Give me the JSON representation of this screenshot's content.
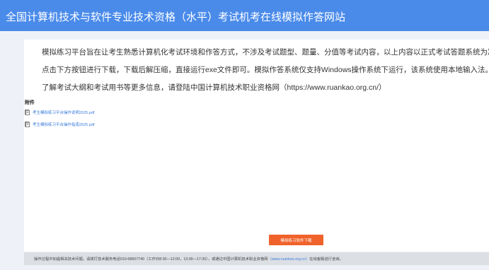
{
  "header": {
    "title": "全国计算机技术与软件专业技术资格（水平）考试机考在线模拟作答网站"
  },
  "intro": {
    "line1": "模拟练习平台旨在让考生熟悉计算机化考试环境和作答方式，不涉及考试题型、题量、分值等考试内容，以上内容以正式考试答题系统为准。",
    "line2": "点击下方按钮进行下载，下载后解压缩，直接运行exe文件即可。模拟作答系统仅支持Windows操作系统下运行，该系统使用本地输入法。",
    "line3": "了解考试大纲和考试用书等更多信息，请登陆中国计算机技术职业资格网（https://www.ruankao.org.cn/）"
  },
  "attachments": {
    "title": "附件",
    "items": [
      {
        "label": "考生模拟练习平台操作说明2025.pdf",
        "icon": "document-icon"
      },
      {
        "label": "考生模拟练习平台操作指南2025.pdf",
        "icon": "document-icon"
      }
    ]
  },
  "start_button": {
    "label": "模拟练习软件下载"
  },
  "footer": {
    "text_before": "操作过程中如遇相关技术问题，请拨打技术服务电话010-68607740（工作日8:30—12:00，13:00—17:30），或通过中国计算机技术职业资格网",
    "link": "（www.ruankao.org.cn）",
    "text_after": "在线客服进行咨询。"
  },
  "colors": {
    "header_bg": "#4a8bea",
    "page_bg": "#eef2f8",
    "button_bg": "#f0622a",
    "link": "#3b7ddd",
    "footer_bg": "#dcdfe4"
  }
}
